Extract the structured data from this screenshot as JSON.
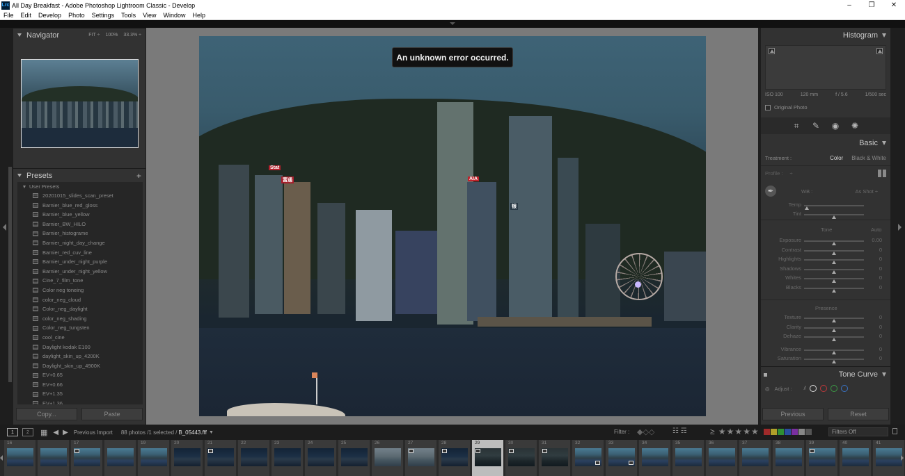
{
  "window": {
    "title": "All Day Breakfast - Adobe Photoshop Lightroom Classic - Develop",
    "app_icon": "Lrc",
    "controls": [
      "–",
      "❐",
      "✕"
    ]
  },
  "menu": [
    "File",
    "Edit",
    "Develop",
    "Photo",
    "Settings",
    "Tools",
    "View",
    "Window",
    "Help"
  ],
  "navigator": {
    "title": "Navigator",
    "zoom": [
      "FIT ÷",
      "100%",
      "33.3% ÷"
    ]
  },
  "presets": {
    "title": "Presets",
    "add": "+",
    "group": "User Presets",
    "items": [
      "20201015_slides_scan_preset",
      "Barnier_blue_red_gloss",
      "Barnier_blue_yellow",
      "Barnier_BW_HILO",
      "Barnier_histograme",
      "Barnier_night_day_change",
      "Barnier_red_cuv_line",
      "Barnier_under_night_purple",
      "Barnier_under_night_yellow",
      "Cine_7_film_tone",
      "Color neg toneing",
      "color_neg_cloud",
      "Color_neg_daylight",
      "color_neg_shading",
      "Color_neg_tungsten",
      "cool_cine",
      "Daylight kodak E100",
      "daylight_skin_up_4200K",
      "Daylight_skin_up_4900K",
      "EV+0.65",
      "EV+0.66",
      "EV+1.35",
      "EV+1.36"
    ],
    "copy_label": "Copy...",
    "paste_label": "Paste"
  },
  "error_toast": "An unknown error occurred.",
  "photo_signs": {
    "sign1": "Stat",
    "sign2": "富通",
    "sign3": "AIA",
    "sign4": "银"
  },
  "histogram": {
    "title": "Histogram",
    "iso": "ISO 100",
    "focal": "120 mm",
    "aperture": "f / 5.6",
    "shutter": "1/500 sec",
    "original_photo": "Original Photo"
  },
  "basic": {
    "title": "Basic",
    "treatment_label": "Treatment :",
    "treatment_color": "Color",
    "treatment_bw": "Black & White",
    "profile_label": "Profile :",
    "profile_value": "÷",
    "wb_label": "WB :",
    "wb_value": "As Shot ÷",
    "tone_label": "Tone",
    "auto_label": "Auto",
    "presence_label": "Presence",
    "wb_sliders": [
      {
        "label": "Temp",
        "value": "",
        "pos": 0.05
      },
      {
        "label": "Tint",
        "value": "",
        "pos": 0.5
      }
    ],
    "tone_sliders": [
      {
        "label": "Exposure",
        "value": "0.00",
        "pos": 0.5
      },
      {
        "label": "Contrast",
        "value": "0",
        "pos": 0.5
      },
      {
        "label": "Highlights",
        "value": "0",
        "pos": 0.5
      },
      {
        "label": "Shadows",
        "value": "0",
        "pos": 0.5
      },
      {
        "label": "Whites",
        "value": "0",
        "pos": 0.5
      },
      {
        "label": "Blacks",
        "value": "0",
        "pos": 0.5
      }
    ],
    "presence_sliders": [
      {
        "label": "Texture",
        "value": "0",
        "pos": 0.5
      },
      {
        "label": "Clarity",
        "value": "0",
        "pos": 0.5
      },
      {
        "label": "Dehaze",
        "value": "0",
        "pos": 0.5
      },
      {
        "label": "Vibrance",
        "value": "0",
        "pos": 0.5
      },
      {
        "label": "Saturation",
        "value": "0",
        "pos": 0.5
      }
    ]
  },
  "tone_curve": {
    "title": "Tone Curve",
    "adjust_label": "Adjust :"
  },
  "previous_label": "Previous",
  "reset_label": "Reset",
  "filmbar": {
    "monitor1": "1",
    "monitor2": "2",
    "source": "Previous Import",
    "count": "88 photos /1 selected /",
    "filename": "B_05443.fff",
    "filter_label": "Filter :",
    "stars": "≥ ★★★★★",
    "filters_off": "Filters Off"
  },
  "filmstrip": [
    {
      "num": "16",
      "style": "day"
    },
    {
      "num": "",
      "style": "day"
    },
    {
      "num": "17",
      "style": "day",
      "badge": true
    },
    {
      "num": "",
      "style": "day"
    },
    {
      "num": "19",
      "style": "day"
    },
    {
      "num": "20",
      "style": "night"
    },
    {
      "num": "21",
      "style": "night",
      "badge": true
    },
    {
      "num": "22",
      "style": "night"
    },
    {
      "num": "23",
      "style": "night"
    },
    {
      "num": "24",
      "style": "night"
    },
    {
      "num": "25",
      "style": "night"
    },
    {
      "num": "26",
      "style": "busy"
    },
    {
      "num": "27",
      "style": "busy",
      "badge": true
    },
    {
      "num": "28",
      "style": "night",
      "badge": true
    },
    {
      "num": "29",
      "style": "dark",
      "badge": true,
      "selected": true
    },
    {
      "num": "30",
      "style": "dark",
      "badge": true
    },
    {
      "num": "31",
      "style": "dark",
      "badge": true
    },
    {
      "num": "32",
      "style": "day",
      "badge2": true
    },
    {
      "num": "33",
      "style": "day",
      "badge2": true
    },
    {
      "num": "34",
      "style": "day"
    },
    {
      "num": "35",
      "style": "day"
    },
    {
      "num": "36",
      "style": "day"
    },
    {
      "num": "37",
      "style": "day"
    },
    {
      "num": "38",
      "style": "day"
    },
    {
      "num": "39",
      "style": "day",
      "badge": true
    },
    {
      "num": "40",
      "style": "day"
    },
    {
      "num": "41",
      "style": "day"
    }
  ]
}
